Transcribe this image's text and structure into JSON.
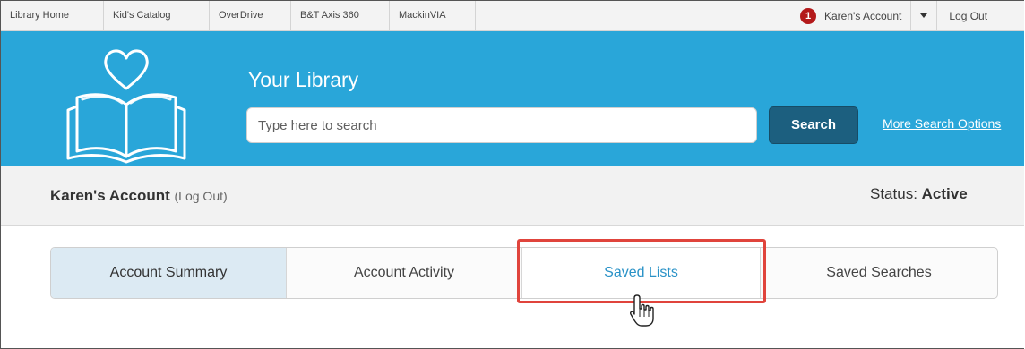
{
  "topnav": {
    "links": [
      "Library Home",
      "Kid's Catalog",
      "OverDrive",
      "B&T Axis 360",
      "MackinVIA"
    ],
    "notification_count": "1",
    "account_label": "Karen's Account",
    "logout_label": "Log Out"
  },
  "header": {
    "library_name": "Your Library",
    "logo_icon": "heart-book-logo",
    "search_placeholder": "Type here to search",
    "search_button": "Search",
    "more_options": "More Search Options"
  },
  "account": {
    "title": "Karen's Account",
    "logout_link": "(Log Out)",
    "status_label": "Status:",
    "status_value": "Active"
  },
  "tabs": [
    "Account Summary",
    "Account Activity",
    "Saved Lists",
    "Saved Searches"
  ],
  "colors": {
    "header_bg": "#29a6d9",
    "search_button_bg": "#1c5f7f",
    "active_tab_bg": "#dceaf3",
    "highlight_border": "#e0443c",
    "notification_badge": "#b3191a"
  }
}
